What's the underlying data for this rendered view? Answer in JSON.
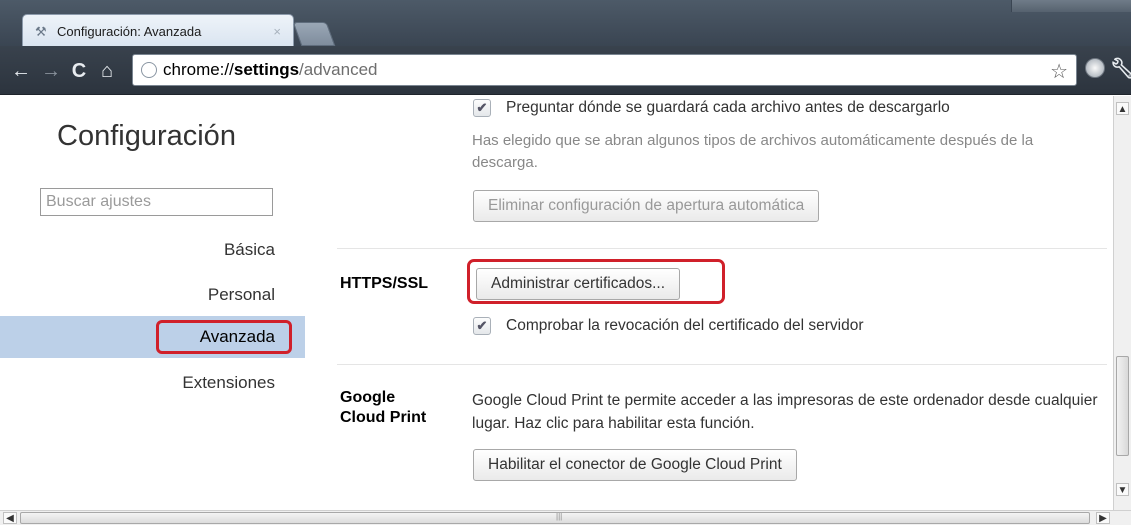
{
  "tab": {
    "title": "Configuración: Avanzada",
    "close": "×"
  },
  "toolbar": {
    "url_prefix": "chrome://",
    "url_host": "settings",
    "url_path": "/advanced"
  },
  "sidebar": {
    "title": "Configuración",
    "search_placeholder": "Buscar ajustes",
    "items": [
      {
        "label": "Básica",
        "selected": false
      },
      {
        "label": "Personal",
        "selected": false
      },
      {
        "label": "Avanzada",
        "selected": true
      },
      {
        "label": "Extensiones",
        "selected": false
      }
    ]
  },
  "downloads": {
    "ask_location_label": "Preguntar dónde se guardará cada archivo antes de descargarlo",
    "ask_location_checked": true,
    "auto_open_note": "Has elegido que se abran algunos tipos de archivos automáticamente después de la descarga.",
    "clear_auto_open_button": "Eliminar configuración de apertura automática"
  },
  "https_ssl": {
    "heading": "HTTPS/SSL",
    "manage_certificates_button": "Administrar certificados...",
    "check_revocation_label": "Comprobar la revocación del certificado del servidor",
    "check_revocation_checked": true
  },
  "cloud_print": {
    "heading_line1": "Google",
    "heading_line2": "Cloud Print",
    "description": "Google Cloud Print te permite acceder a las impresoras de este ordenador desde cualquier lugar. Haz clic para habilitar esta función.",
    "enable_button": "Habilitar el conector de Google Cloud Print"
  },
  "icons": {
    "back": "back-arrow-icon",
    "forward": "forward-arrow-icon",
    "reload": "reload-icon",
    "home": "home-icon",
    "star": "star-icon",
    "wrench": "wrench-icon"
  },
  "colors": {
    "highlight_border": "#d0202a",
    "selected_nav_bg": "#bcd0e8"
  }
}
